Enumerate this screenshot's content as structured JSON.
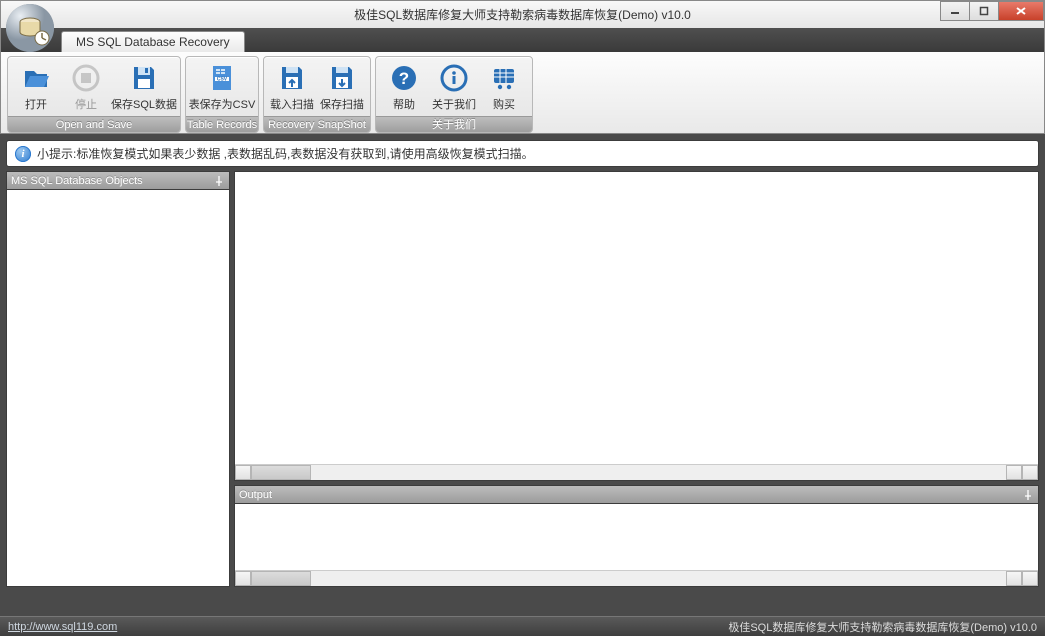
{
  "window": {
    "title": "极佳SQL数据库修复大师支持勒索病毒数据库恢复(Demo) v10.0"
  },
  "tab": {
    "label": "MS SQL Database Recovery"
  },
  "ribbon": {
    "groups": [
      {
        "footer": "Open and Save",
        "items": [
          {
            "key": "open",
            "label": "打开"
          },
          {
            "key": "stop",
            "label": "停止"
          },
          {
            "key": "savesql",
            "label": "保存SQL数据"
          }
        ]
      },
      {
        "footer": "Table Records",
        "items": [
          {
            "key": "savecsv",
            "label": "表保存为CSV"
          }
        ]
      },
      {
        "footer": "Recovery SnapShot",
        "items": [
          {
            "key": "loadscan",
            "label": "载入扫描"
          },
          {
            "key": "savescan",
            "label": "保存扫描"
          }
        ]
      },
      {
        "footer": "关于我们",
        "items": [
          {
            "key": "help",
            "label": "帮助"
          },
          {
            "key": "about",
            "label": "关于我们"
          },
          {
            "key": "buy",
            "label": "购买"
          }
        ]
      }
    ]
  },
  "infobar": {
    "text": "小提示:标准恢复模式如果表少数据 ,表数据乱码,表数据没有获取到,请使用高级恢复模式扫描。"
  },
  "panels": {
    "left_title": "MS SQL Database Objects",
    "output_title": "Output"
  },
  "statusbar": {
    "url": "http://www.sql119.com",
    "right": "极佳SQL数据库修复大师支持勒索病毒数据库恢复(Demo) v10.0"
  }
}
